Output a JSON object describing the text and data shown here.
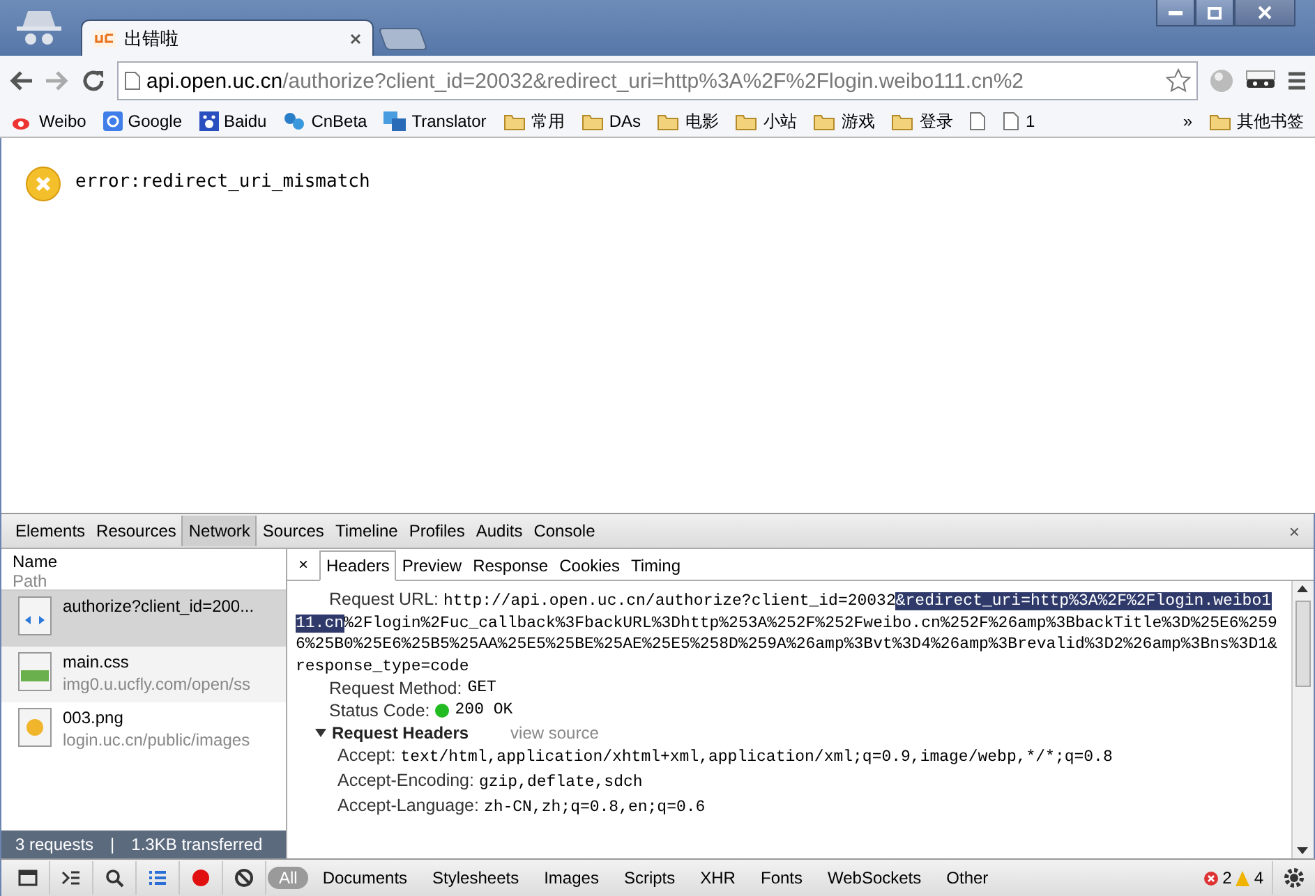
{
  "window": {
    "tabs": [
      {
        "title": "出错啦",
        "selected": true
      },
      {
        "kind": "new-tab",
        "selected": false
      }
    ]
  },
  "address_bar": {
    "host": "api.open.uc.cn",
    "path": "/authorize?client_id=20032&redirect_uri=http%3A%2F%2Flogin.weibo111.cn%2"
  },
  "bookmarks": [
    {
      "kind": "weibo",
      "label": "Weibo"
    },
    {
      "kind": "google",
      "label": "Google"
    },
    {
      "kind": "baidu",
      "label": "Baidu"
    },
    {
      "kind": "cnbeta",
      "label": "CnBeta"
    },
    {
      "kind": "translator",
      "label": "Translator"
    },
    {
      "kind": "folder",
      "label": "常用"
    },
    {
      "kind": "folder",
      "label": "DAs"
    },
    {
      "kind": "folder",
      "label": "电影"
    },
    {
      "kind": "folder",
      "label": "小站"
    },
    {
      "kind": "folder",
      "label": "游戏"
    },
    {
      "kind": "folder",
      "label": "登录"
    },
    {
      "kind": "page"
    },
    {
      "kind": "page",
      "label": "1"
    }
  ],
  "bookmarks_overflow": "»",
  "other_bookmarks": "其他书签",
  "page": {
    "error": "error:redirect_uri_mismatch"
  },
  "devtools": {
    "tabs": [
      {
        "label": "Elements",
        "selected": false
      },
      {
        "label": "Resources",
        "selected": false
      },
      {
        "label": "Network",
        "selected": true
      },
      {
        "label": "Sources",
        "selected": false
      },
      {
        "label": "Timeline",
        "selected": false
      },
      {
        "label": "Profiles",
        "selected": false
      },
      {
        "label": "Audits",
        "selected": false
      },
      {
        "label": "Console",
        "selected": false
      }
    ],
    "close": "×",
    "network": {
      "columns": [
        "Name",
        "Path"
      ],
      "requests": [
        {
          "kind": "html",
          "name": "authorize?client_id=200...",
          "selected": true
        },
        {
          "kind": "css",
          "name": "main.css",
          "path": "img0.u.ucfly.com/open/ss",
          "selected": false
        },
        {
          "kind": "image",
          "name": "003.png",
          "path": "login.uc.cn/public/images",
          "selected": false
        }
      ],
      "summary": {
        "requests": "3 requests",
        "separator": "|",
        "transferred": "1.3KB transferred"
      }
    },
    "detail_close": "×",
    "detail_tabs": [
      {
        "label": "Headers",
        "selected": true
      },
      {
        "label": "Preview",
        "selected": false
      },
      {
        "label": "Response",
        "selected": false
      },
      {
        "label": "Cookies",
        "selected": false
      },
      {
        "label": "Timing",
        "selected": false
      }
    ],
    "request_url": {
      "label": "Request URL:",
      "parts": [
        {
          "text": "http://api.open.uc.cn/authorize?client_id=20032",
          "selected": false
        },
        {
          "text": "&redirect_uri=http%3A%2F%2Flogin.weibo111.cn",
          "selected": true
        },
        {
          "text": "%2Flogin%2Fuc_callback%3FbackURL%3Dhttp%253A%252F%252Fweibo.cn%252F%26amp%3BbackTitle%3D%25E6%2596%25B0%25E6%25B5%25AA%25E5%25BE%25AE%25E5%258D%259A%26amp%3Bvt%3D4%26amp%3Brevalid%3D2%26amp%3Bns%3D1&response_type=code",
          "selected": false
        }
      ]
    },
    "request_method": {
      "label": "Request Method:",
      "value": "GET"
    },
    "status_code": {
      "label": "Status Code:",
      "value": "200 OK",
      "color": "#22bb22"
    },
    "request_headers": {
      "title": "Request Headers",
      "expanded": true,
      "view_source": "view source",
      "items": [
        {
          "name": "Accept:",
          "value": "text/html,application/xhtml+xml,application/xml;q=0.9,image/webp,*/*;q=0.8"
        },
        {
          "name": "Accept-Encoding:",
          "value": "gzip,deflate,sdch"
        },
        {
          "name": "Accept-Language:",
          "value": "zh-CN,zh;q=0.8,en;q=0.6"
        }
      ]
    },
    "toolbar": {
      "recording": true
    },
    "filters": [
      {
        "label": "All",
        "selected": true
      },
      {
        "label": "Documents",
        "selected": false
      },
      {
        "label": "Stylesheets",
        "selected": false
      },
      {
        "label": "Images",
        "selected": false
      },
      {
        "label": "Scripts",
        "selected": false
      },
      {
        "label": "XHR",
        "selected": false
      },
      {
        "label": "Fonts",
        "selected": false
      },
      {
        "label": "WebSockets",
        "selected": false
      },
      {
        "label": "Other",
        "selected": false
      }
    ],
    "errors": "2",
    "warnings": "4"
  }
}
